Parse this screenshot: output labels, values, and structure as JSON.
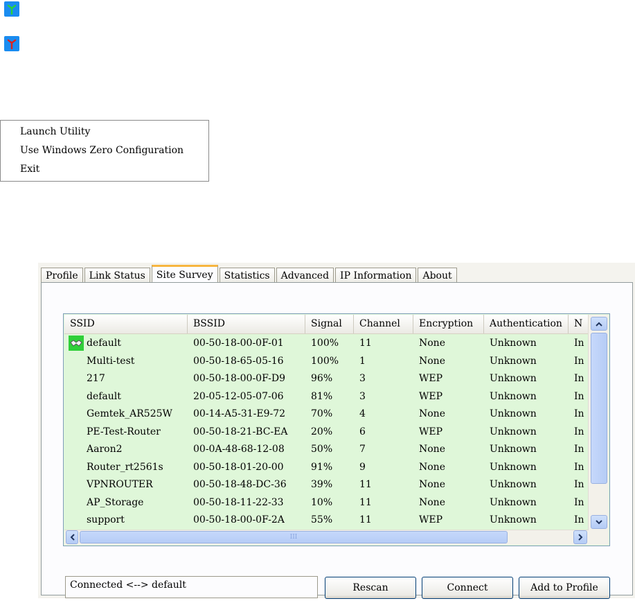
{
  "tray": {
    "icon_connected": "antenna-green-icon",
    "icon_disconnected": "antenna-red-icon"
  },
  "menu": {
    "items": [
      "Launch Utility",
      "Use Windows Zero Configuration",
      "Exit"
    ]
  },
  "tabs": [
    "Profile",
    "Link Status",
    "Site Survey",
    "Statistics",
    "Advanced",
    "IP Information",
    "About"
  ],
  "active_tab": "Site Survey",
  "table": {
    "columns": [
      "SSID",
      "BSSID",
      "Signal",
      "Channel",
      "Encryption",
      "Authentication",
      "N"
    ],
    "rows": [
      {
        "ssid": "default",
        "bssid": "00-50-18-00-0F-01",
        "signal": "100%",
        "channel": "11",
        "encryption": "None",
        "auth": "Unknown",
        "n": "In"
      },
      {
        "ssid": "Multi-test",
        "bssid": "00-50-18-65-05-16",
        "signal": "100%",
        "channel": "1",
        "encryption": "None",
        "auth": "Unknown",
        "n": "In"
      },
      {
        "ssid": "217",
        "bssid": "00-50-18-00-0F-D9",
        "signal": "96%",
        "channel": "3",
        "encryption": "WEP",
        "auth": "Unknown",
        "n": "In"
      },
      {
        "ssid": "default",
        "bssid": "20-05-12-05-07-06",
        "signal": "81%",
        "channel": "3",
        "encryption": "WEP",
        "auth": "Unknown",
        "n": "In"
      },
      {
        "ssid": "Gemtek_AR525W",
        "bssid": "00-14-A5-31-E9-72",
        "signal": "70%",
        "channel": "4",
        "encryption": "None",
        "auth": "Unknown",
        "n": "In"
      },
      {
        "ssid": "PE-Test-Router",
        "bssid": "00-50-18-21-BC-EA",
        "signal": "20%",
        "channel": "6",
        "encryption": "WEP",
        "auth": "Unknown",
        "n": "In"
      },
      {
        "ssid": "Aaron2",
        "bssid": "00-0A-48-68-12-08",
        "signal": "50%",
        "channel": "7",
        "encryption": "None",
        "auth": "Unknown",
        "n": "In"
      },
      {
        "ssid": "Router_rt2561s",
        "bssid": "00-50-18-01-20-00",
        "signal": "91%",
        "channel": "9",
        "encryption": "None",
        "auth": "Unknown",
        "n": "In"
      },
      {
        "ssid": "VPNROUTER",
        "bssid": "00-50-18-48-DC-36",
        "signal": "39%",
        "channel": "11",
        "encryption": "None",
        "auth": "Unknown",
        "n": "In"
      },
      {
        "ssid": "AP_Storage",
        "bssid": "00-50-18-11-22-33",
        "signal": "10%",
        "channel": "11",
        "encryption": "None",
        "auth": "Unknown",
        "n": "In"
      },
      {
        "ssid": "support",
        "bssid": "00-50-18-00-0F-2A",
        "signal": "55%",
        "channel": "11",
        "encryption": "WEP",
        "auth": "Unknown",
        "n": "In"
      }
    ],
    "connected_row_icon": "handshake-icon"
  },
  "hscroll_grip": "III",
  "status_text": "Connected <--> default",
  "buttons": {
    "rescan": "Rescan",
    "connect": "Connect",
    "add_to_profile": "Add to Profile"
  },
  "colors": {
    "list_background": "#dff7d9",
    "tray_icon_bg": "#1a8cf0",
    "active_tab_accent": "#f7b640"
  }
}
